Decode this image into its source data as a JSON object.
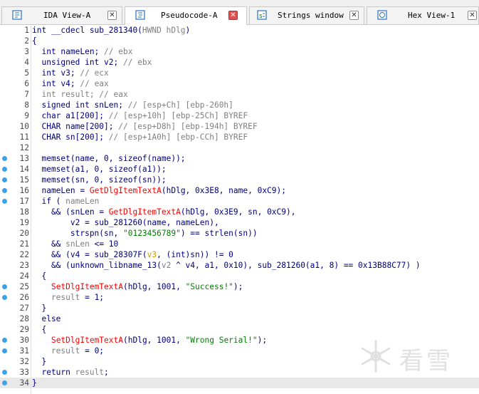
{
  "tabs": [
    {
      "label": "IDA View-A",
      "active": false,
      "icon": "ida-view-icon"
    },
    {
      "label": "Pseudocode-A",
      "active": true,
      "icon": "pseudocode-icon"
    },
    {
      "label": "Strings window",
      "active": false,
      "icon": "strings-icon"
    },
    {
      "label": "Hex View-1",
      "active": false,
      "icon": "hex-view-icon"
    }
  ],
  "lines": [
    {
      "n": "1",
      "dot": false,
      "segs": [
        [
          "c-kw",
          "int __cdecl sub_281340("
        ],
        [
          "c-lvar",
          "HWND hDlg"
        ],
        [
          "c-kw",
          ")"
        ]
      ]
    },
    {
      "n": "2",
      "dot": false,
      "segs": [
        [
          "c-kw",
          "{"
        ]
      ]
    },
    {
      "n": "3",
      "dot": false,
      "segs": [
        [
          "c-kw",
          "  int nameLen; "
        ],
        [
          "c-cmt",
          "// ebx"
        ]
      ]
    },
    {
      "n": "4",
      "dot": false,
      "segs": [
        [
          "c-kw",
          "  unsigned int v2; "
        ],
        [
          "c-cmt",
          "// ebx"
        ]
      ]
    },
    {
      "n": "5",
      "dot": false,
      "segs": [
        [
          "c-kw",
          "  int v3; "
        ],
        [
          "c-cmt",
          "// ecx"
        ]
      ]
    },
    {
      "n": "6",
      "dot": false,
      "segs": [
        [
          "c-kw",
          "  int v4; "
        ],
        [
          "c-cmt",
          "// eax"
        ]
      ]
    },
    {
      "n": "7",
      "dot": false,
      "segs": [
        [
          "c-lvar",
          "  int result; "
        ],
        [
          "c-cmt",
          "// eax"
        ]
      ]
    },
    {
      "n": "8",
      "dot": false,
      "segs": [
        [
          "c-kw",
          "  signed int snLen; "
        ],
        [
          "c-cmt",
          "// [esp+Ch] [ebp-260h]"
        ]
      ]
    },
    {
      "n": "9",
      "dot": false,
      "segs": [
        [
          "c-kw",
          "  char a1[200]; "
        ],
        [
          "c-cmt",
          "// [esp+10h] [ebp-25Ch] BYREF"
        ]
      ]
    },
    {
      "n": "10",
      "dot": false,
      "segs": [
        [
          "c-kw",
          "  CHAR name[200]; "
        ],
        [
          "c-cmt",
          "// [esp+D8h] [ebp-194h] BYREF"
        ]
      ]
    },
    {
      "n": "11",
      "dot": false,
      "segs": [
        [
          "c-kw",
          "  CHAR sn[200]; "
        ],
        [
          "c-cmt",
          "// [esp+1A0h] [ebp-CCh] BYREF"
        ]
      ]
    },
    {
      "n": "12",
      "dot": false,
      "segs": []
    },
    {
      "n": "13",
      "dot": true,
      "segs": [
        [
          "c-kw",
          "  memset(name, 0, sizeof(name));"
        ]
      ]
    },
    {
      "n": "14",
      "dot": true,
      "segs": [
        [
          "c-kw",
          "  memset(a1, 0, sizeof(a1));"
        ]
      ]
    },
    {
      "n": "15",
      "dot": true,
      "segs": [
        [
          "c-kw",
          "  memset(sn, 0, sizeof(sn));"
        ]
      ]
    },
    {
      "n": "16",
      "dot": true,
      "segs": [
        [
          "c-kw",
          "  nameLen = "
        ],
        [
          "c-fn",
          "GetDlgItemTextA"
        ],
        [
          "c-kw",
          "(hDlg, 0x3E8, name, 0xC9);"
        ]
      ]
    },
    {
      "n": "17",
      "dot": true,
      "segs": [
        [
          "c-kw",
          "  if ( "
        ],
        [
          "c-lvar",
          "nameLen"
        ]
      ]
    },
    {
      "n": "18",
      "dot": false,
      "segs": [
        [
          "c-kw",
          "    && (snLen = "
        ],
        [
          "c-fn",
          "GetDlgItemTextA"
        ],
        [
          "c-kw",
          "(hDlg, 0x3E9, sn, 0xC9),"
        ]
      ]
    },
    {
      "n": "19",
      "dot": false,
      "segs": [
        [
          "c-kw",
          "        v2 = sub_281260(name, nameLen),"
        ]
      ]
    },
    {
      "n": "20",
      "dot": false,
      "segs": [
        [
          "c-kw",
          "        strspn(sn, "
        ],
        [
          "c-str",
          "\"0123456789\""
        ],
        [
          "c-kw",
          ") == strlen(sn))"
        ]
      ]
    },
    {
      "n": "21",
      "dot": false,
      "segs": [
        [
          "c-kw",
          "    && "
        ],
        [
          "c-lvar",
          "snLen"
        ],
        [
          "c-kw",
          " <= 10"
        ]
      ]
    },
    {
      "n": "22",
      "dot": false,
      "segs": [
        [
          "c-kw",
          "    && (v4 = sub_28307F("
        ],
        [
          "c-y",
          "v3"
        ],
        [
          "c-kw",
          ", (int)sn)) != 0"
        ]
      ]
    },
    {
      "n": "23",
      "dot": false,
      "segs": [
        [
          "c-kw",
          "    && (unknown_libname_13("
        ],
        [
          "c-lvar",
          "v2"
        ],
        [
          "c-kw",
          " ^ v4, a1, 0x10), sub_281260(a1, 8) == 0x13B88C77) )"
        ]
      ]
    },
    {
      "n": "24",
      "dot": false,
      "segs": [
        [
          "c-kw",
          "  {"
        ]
      ]
    },
    {
      "n": "25",
      "dot": true,
      "segs": [
        [
          "c-kw",
          "    "
        ],
        [
          "c-fn",
          "SetDlgItemTextA"
        ],
        [
          "c-kw",
          "(hDlg, 1001, "
        ],
        [
          "c-str",
          "\"Success!\""
        ],
        [
          "c-kw",
          ");"
        ]
      ]
    },
    {
      "n": "26",
      "dot": true,
      "segs": [
        [
          "c-lvar",
          "    result"
        ],
        [
          "c-kw",
          " = 1;"
        ]
      ]
    },
    {
      "n": "27",
      "dot": false,
      "segs": [
        [
          "c-kw",
          "  }"
        ]
      ]
    },
    {
      "n": "28",
      "dot": false,
      "segs": [
        [
          "c-kw",
          "  else"
        ]
      ]
    },
    {
      "n": "29",
      "dot": false,
      "segs": [
        [
          "c-kw",
          "  {"
        ]
      ]
    },
    {
      "n": "30",
      "dot": true,
      "segs": [
        [
          "c-kw",
          "    "
        ],
        [
          "c-fn",
          "SetDlgItemTextA"
        ],
        [
          "c-kw",
          "(hDlg, 1001, "
        ],
        [
          "c-str",
          "\"Wrong Serial!\""
        ],
        [
          "c-kw",
          ");"
        ]
      ]
    },
    {
      "n": "31",
      "dot": true,
      "segs": [
        [
          "c-lvar",
          "    result"
        ],
        [
          "c-kw",
          " = 0;"
        ]
      ]
    },
    {
      "n": "32",
      "dot": false,
      "segs": [
        [
          "c-kw",
          "  }"
        ]
      ]
    },
    {
      "n": "33",
      "dot": true,
      "segs": [
        [
          "c-kw",
          "  return "
        ],
        [
          "c-lvar",
          "result"
        ],
        [
          "c-kw",
          ";"
        ]
      ]
    },
    {
      "n": "34",
      "dot": true,
      "segs": [
        [
          "c-kw",
          "}"
        ]
      ]
    }
  ],
  "current_line": "34",
  "watermark": {
    "text": "看雪",
    "icon": "snowflake-icon"
  },
  "colors": {
    "breakpoint_dot": "#3aa3e8",
    "function": "#ff0000",
    "string": "#008000",
    "comment": "#808080",
    "code": "#000080"
  }
}
